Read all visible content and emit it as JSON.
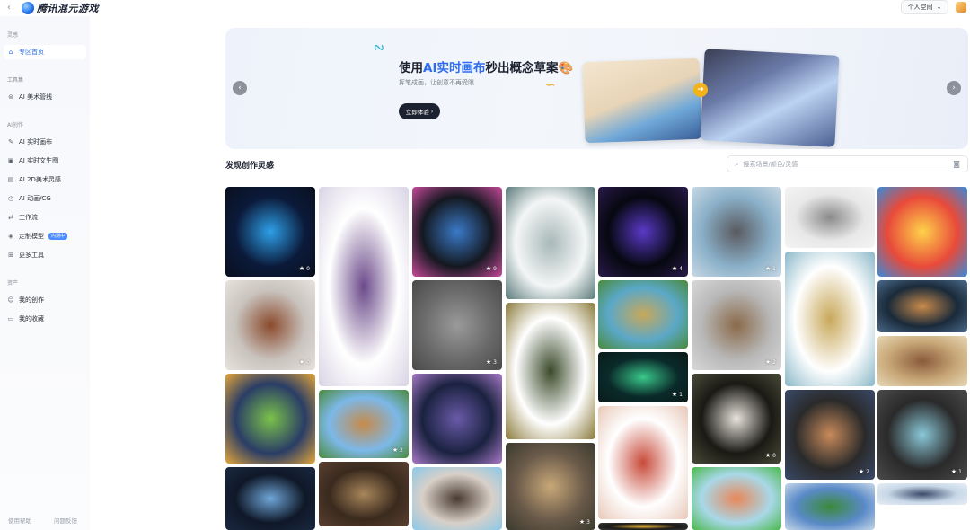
{
  "topbar": {
    "back_icon": "chevron-left-icon",
    "app_name": "腾讯混元游戏",
    "space_label": "个人空间",
    "space_icon": "chevron-down-icon"
  },
  "sidebar": {
    "sections": [
      {
        "title": "灵感",
        "items": [
          {
            "label": "专区首页",
            "icon": "home-icon",
            "active": true
          }
        ]
      },
      {
        "title": "工具集",
        "items": [
          {
            "label": "AI 美术管线",
            "icon": "pipeline-icon"
          }
        ]
      },
      {
        "title": "AI创作",
        "items": [
          {
            "label": "AI 实时画布",
            "icon": "canvas-icon"
          },
          {
            "label": "AI 实时文生图",
            "icon": "image-icon"
          },
          {
            "label": "AI 2D美术灵感",
            "icon": "palette-icon"
          },
          {
            "label": "AI 动画/CG",
            "icon": "animation-icon"
          },
          {
            "label": "工作流",
            "icon": "workflow-icon"
          },
          {
            "label": "定制模型",
            "icon": "model-icon",
            "badge": "内测中"
          },
          {
            "label": "更多工具",
            "icon": "grid-icon"
          }
        ]
      },
      {
        "title": "资产",
        "items": [
          {
            "label": "我的创作",
            "icon": "user-icon"
          },
          {
            "label": "我的收藏",
            "icon": "folder-icon"
          }
        ]
      }
    ],
    "footer": {
      "help": "使用帮助",
      "feedback": "问题反馈"
    }
  },
  "banner": {
    "title_pre": "使用",
    "title_hl": "AI实时画布",
    "title_post": "秒出概念草案🎨",
    "subtitle": "挥笔成画，让创意不再受限",
    "cta": "立即体验",
    "cta_icon": "chevron-right-icon",
    "prev_icon": "chevron-left-icon",
    "next_icon": "chevron-right-icon",
    "compare_icon": "arrow-right-icon"
  },
  "gallery": {
    "title": "发现创作灵感",
    "search_placeholder": "搜索场景/颜色/灵感",
    "search_icon": "search-icon",
    "camera_icon": "camera-icon",
    "tiles": [
      {
        "col": 0,
        "likes": "0",
        "colors": [
          "#0b1a3a",
          "#2ea0e8",
          "#0a0f1e"
        ]
      },
      {
        "col": 0,
        "likes": "0",
        "colors": [
          "#c9c3be",
          "#8a4a2c",
          "#e8e2dc"
        ]
      },
      {
        "col": 0,
        "likes": "",
        "colors": [
          "#2a3d66",
          "#7bc24a",
          "#e4a63a"
        ]
      },
      {
        "col": 0,
        "likes": "",
        "colors": [
          "#0f1828",
          "#6fa6d8",
          "#1a2840"
        ]
      },
      {
        "col": 1,
        "likes": "",
        "colors": [
          "#ffffff",
          "#6b4a8a",
          "#d9d3e4"
        ]
      },
      {
        "col": 1,
        "likes": "2",
        "colors": [
          "#7cb8e8",
          "#c68a4a",
          "#4a8a3a"
        ]
      },
      {
        "col": 1,
        "likes": "",
        "colors": [
          "#3a2a1e",
          "#a8865a",
          "#5a4030"
        ]
      },
      {
        "col": 2,
        "likes": "9",
        "colors": [
          "#141820",
          "#3a7ac8",
          "#c84a9a"
        ]
      },
      {
        "col": 2,
        "likes": "3",
        "colors": [
          "#6a6a6a",
          "#9a9a9a",
          "#4a4a4a"
        ]
      },
      {
        "col": 2,
        "likes": "",
        "colors": [
          "#1a2240",
          "#6a5aa8",
          "#a87ac8"
        ]
      },
      {
        "col": 2,
        "likes": "",
        "colors": [
          "#d8d0c8",
          "#4a3a30",
          "#8ac8e8"
        ]
      },
      {
        "col": 3,
        "likes": "",
        "colors": [
          "#f4f6f6",
          "#a8b8b8",
          "#5a7a7a"
        ]
      },
      {
        "col": 3,
        "likes": "",
        "colors": [
          "#ffffff",
          "#3a4a2a",
          "#8a7a3a"
        ]
      },
      {
        "col": 3,
        "likes": "3",
        "colors": [
          "#6a5a4a",
          "#c8a878",
          "#3a3a2e"
        ]
      },
      {
        "col": 4,
        "likes": "4",
        "colors": [
          "#060810",
          "#5a3ac8",
          "#2a1a4a"
        ]
      },
      {
        "col": 4,
        "likes": "",
        "colors": [
          "#5aa8c8",
          "#c8a85a",
          "#4a8a3a"
        ]
      },
      {
        "col": 4,
        "likes": "1",
        "colors": [
          "#0a2a2a",
          "#3ac88a",
          "#0a1a1a"
        ]
      },
      {
        "col": 4,
        "likes": "",
        "colors": [
          "#ffffff",
          "#c84a3a",
          "#e8c8b8"
        ]
      },
      {
        "col": 4,
        "likes": "",
        "colors": [
          "#1a1a1a",
          "#e8b83a",
          "#3a3a3a"
        ]
      },
      {
        "col": 5,
        "likes": "1",
        "colors": [
          "#8ab0c8",
          "#5a5a60",
          "#c8d8e4"
        ]
      },
      {
        "col": 5,
        "likes": "2",
        "colors": [
          "#b8b8b8",
          "#8a6a4a",
          "#d8d8d8"
        ]
      },
      {
        "col": 5,
        "likes": "0",
        "colors": [
          "#1a1a14",
          "#e8e4dc",
          "#4a4a3a"
        ]
      },
      {
        "col": 5,
        "likes": "",
        "colors": [
          "#a8d8e8",
          "#e8885a",
          "#4ab84a"
        ]
      },
      {
        "col": 6,
        "likes": "",
        "colors": [
          "#e8e8e8",
          "#8a8a8a",
          "#f4f4f4"
        ]
      },
      {
        "col": 6,
        "likes": "",
        "colors": [
          "#ffffff",
          "#c8a85a",
          "#8ab8c8"
        ]
      },
      {
        "col": 6,
        "likes": "2",
        "colors": [
          "#2a2a2a",
          "#c88a5a",
          "#3a4a6a"
        ]
      },
      {
        "col": 6,
        "likes": "",
        "colors": [
          "#5a8ac8",
          "#3a8a3a",
          "#c8d8e8"
        ]
      },
      {
        "col": 7,
        "likes": "",
        "colors": [
          "#e84a3a",
          "#ffd24a",
          "#3a8ad8"
        ]
      },
      {
        "col": 7,
        "likes": "",
        "colors": [
          "#1a2a3a",
          "#c88a4a",
          "#4a6a8a"
        ]
      },
      {
        "col": 7,
        "likes": "",
        "colors": [
          "#c8a878",
          "#8a5a3a",
          "#e8d8b8"
        ]
      },
      {
        "col": 7,
        "likes": "1",
        "colors": [
          "#2a2a2a",
          "#8ac8d8",
          "#4a4a4a"
        ]
      },
      {
        "col": 7,
        "likes": "",
        "colors": [
          "#c8d8e8",
          "#3a4a6a",
          "#e8eef4"
        ]
      }
    ]
  }
}
